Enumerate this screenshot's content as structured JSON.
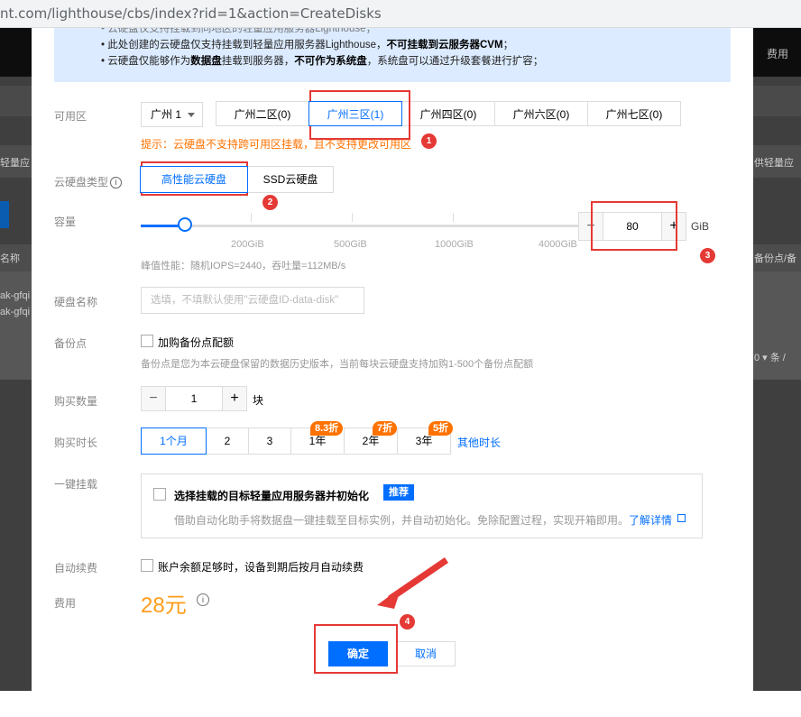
{
  "browser": {
    "url": "nt.com/lighthouse/cbs/index?rid=1&action=CreateDisks"
  },
  "background": {
    "header_fee": "费用",
    "left_texts": [
      "轻量应",
      "名称",
      "ak-gfqi",
      "ak-gfqi"
    ],
    "right_texts": [
      "供轻量应",
      "备份点/备",
      "0 ▾  条 /"
    ]
  },
  "notice": {
    "line1": "• 云硬盘仅支持挂载到同地区的轻量应用服务器Lighthouse；",
    "line2_prefix": "• 此处创建的云硬盘仅支持挂载到轻量应用服务器Lighthouse，",
    "line2_bold": "不可挂载到云服务器CVM",
    "line2_suffix": "；",
    "line3_prefix": "• 云硬盘仅能够作为",
    "line3_bold1": "数据盘",
    "line3_mid": "挂载到服务器，",
    "line3_bold2": "不可作为系统盘",
    "line3_suffix": "，系统盘可以通过升级套餐进行扩容；"
  },
  "zone": {
    "label": "可用区",
    "region": "广州 1",
    "options": [
      "广州二区(0)",
      "广州三区(1)",
      "广州四区(0)",
      "广州六区(0)",
      "广州七区(0)"
    ],
    "selected_index": 1,
    "tip": "提示：云硬盘不支持跨可用区挂载，且不支持更改可用区"
  },
  "disk_type": {
    "label": "云硬盘类型",
    "info_icon": "i",
    "options": [
      "高性能云硬盘",
      "SSD云硬盘"
    ],
    "selected_index": 0
  },
  "capacity": {
    "label": "容量",
    "ticks": [
      "200GiB",
      "500GiB",
      "1000GiB",
      "4000GiB"
    ],
    "value": "80",
    "unit": "GiB",
    "slider_fraction": 0.1,
    "minus": "−",
    "plus": "+",
    "perf": "峰值性能：随机IOPS=2440，吞吐量=112MB/s"
  },
  "disk_name": {
    "label": "硬盘名称",
    "placeholder": "选填，不填默认使用\"云硬盘ID-data-disk\""
  },
  "backup": {
    "label": "备份点",
    "checkbox_label": "加购备份点配额",
    "desc": "备份点是您为本云硬盘保留的数据历史版本，当前每块云硬盘支持加购1-500个备份点配额"
  },
  "quantity": {
    "label": "购买数量",
    "value": "1",
    "unit": "块",
    "minus": "−",
    "plus": "+"
  },
  "duration": {
    "label": "购买时长",
    "options": [
      "1个月",
      "2",
      "3",
      "1年",
      "2年",
      "3年"
    ],
    "selected_index": 0,
    "discounts": [
      "8.3折",
      "7折",
      "5折"
    ],
    "other_link": "其他时长"
  },
  "mount": {
    "label": "一键挂载",
    "checkbox_label": "选择挂载的目标轻量应用服务器并初始化",
    "tag": "推荐",
    "desc": "借助自动化助手将数据盘一键挂载至目标实例，并自动初始化。免除配置过程，实现开箱即用。",
    "link": "了解详情"
  },
  "auto_renew": {
    "label": "自动续费",
    "checkbox_label": "账户余额足够时，设备到期后按月自动续费"
  },
  "fee": {
    "label": "费用",
    "price": "28元",
    "info_icon": "i"
  },
  "actions": {
    "confirm": "确定",
    "cancel": "取消"
  },
  "annotations": {
    "markers": [
      "1",
      "2",
      "3",
      "4"
    ],
    "color": "#e53935"
  },
  "colors": {
    "accent": "#006eff",
    "price": "#ff9c19",
    "tip": "#ff7200",
    "notice_bg": "#dcebff"
  }
}
